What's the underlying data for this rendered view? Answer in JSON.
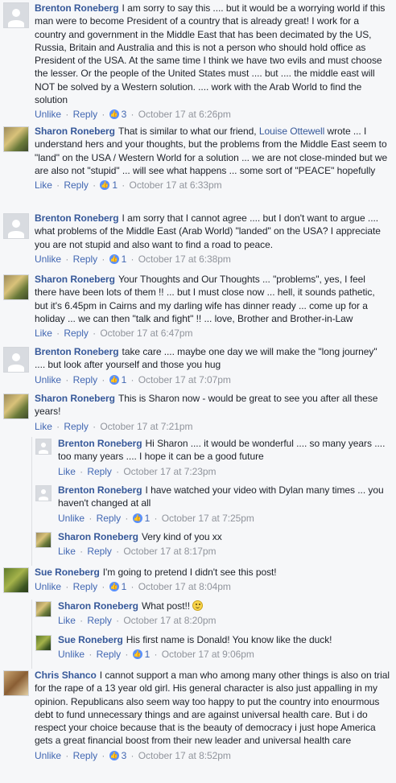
{
  "actions": {
    "like": "Like",
    "unlike": "Unlike",
    "reply": "Reply",
    "sep": "·"
  },
  "comments": [
    {
      "author": "Brenton Roneberg",
      "avatar": "default-avatar",
      "text": "I am sorry to say this .... but it would be a worrying world if this man were to become President of a country that is already great! I work for a country and government in the Middle East that has been decimated by the US, Russia, Britain and Australia and this is not a person who should hold office as President of the USA. At the same time I think we have two evils and must choose the lesser. Or the people of the United States must .... but .... the middle east will NOT be solved by a Western solution. .... work with the Arab World to find the solution",
      "like_action": "Unlike",
      "like_count": "3",
      "time": "October 17 at 6:26pm"
    },
    {
      "author": "Sharon Roneberg",
      "avatar": "sharon-photo",
      "text_before": "That is similar to what our friend,",
      "mention": "Louise Ottewell",
      "text_after": "wrote ... I understand hers and your thoughts, but the problems from the Middle East seem to \"land\" on the USA / Western World for a solution ... we are not close-minded but we are also not \"stupid\" ... will see what happens ... some sort of \"PEACE\" hopefully",
      "like_action": "Like",
      "like_count": "1",
      "time": "October 17 at 6:33pm"
    },
    {
      "author": "Brenton Roneberg",
      "avatar": "default-avatar",
      "text": "I am sorry that I cannot agree .... but I don't want to argue .... what problems of the Middle East (Arab World) \"landed\" on the USA? I appreciate you are not stupid and also want to find a road to peace.",
      "like_action": "Unlike",
      "like_count": "1",
      "time": "October 17 at 6:38pm"
    },
    {
      "author": "Sharon Roneberg",
      "avatar": "sharon-photo",
      "text": "Your Thoughts and Our Thoughts ... \"problems\", yes, I feel there have been lots of them !! ... but I must close now ... hell, it sounds pathetic, but it's 6.45pm in Cairns and my darling wife has dinner ready ... come up for a holiday ... we can then \"talk and fight\" !! ... love, Brother and Brother-in-Law",
      "like_action": "Like",
      "time": "October 17 at 6:47pm"
    },
    {
      "author": "Brenton Roneberg",
      "avatar": "default-avatar",
      "text": "take care .... maybe one day we will make the \"long journey\" .... but look after yourself and those you hug",
      "like_action": "Unlike",
      "like_count": "1",
      "time": "October 17 at 7:07pm"
    },
    {
      "author": "Sharon Roneberg",
      "avatar": "sharon-photo",
      "text": "This is Sharon now - would be great to see you after all these years!",
      "like_action": "Like",
      "time": "October 17 at 7:21pm",
      "replies": [
        {
          "author": "Brenton Roneberg",
          "avatar": "default-avatar",
          "text": "Hi Sharon .... it would be wonderful .... so many years .... too many years .... I hope it can be a good future",
          "like_action": "Like",
          "time": "October 17 at 7:23pm"
        },
        {
          "author": "Brenton Roneberg",
          "avatar": "default-avatar",
          "text": "I have watched your video with Dylan many times ... you haven't changed at all",
          "like_action": "Unlike",
          "like_count": "1",
          "time": "October 17 at 7:25pm"
        },
        {
          "author": "Sharon Roneberg",
          "avatar": "sharon-photo",
          "text": "Very kind of you xx",
          "like_action": "Like",
          "time": "October 17 at 8:17pm"
        }
      ]
    },
    {
      "author": "Sue Roneberg",
      "avatar": "sue-photo",
      "text": "I'm going to pretend I didn't see this post!",
      "like_action": "Unlike",
      "like_count": "1",
      "time": "October 17 at 8:04pm",
      "replies": [
        {
          "author": "Sharon Roneberg",
          "avatar": "sharon-photo",
          "text": "What post!!",
          "emoji": "smile-icon",
          "like_action": "Like",
          "time": "October 17 at 8:20pm"
        },
        {
          "author": "Sue Roneberg",
          "avatar": "sue-photo",
          "text": "His first name is Donald! You know like the duck!",
          "like_action": "Unlike",
          "like_count": "1",
          "time": "October 17 at 9:06pm"
        }
      ]
    },
    {
      "author": "Chris Shanco",
      "avatar": "chris-photo",
      "text": "I cannot support a man who among many other things is also on trial for the rape of a 13 year old girl. His general character is also just appalling in my opinion. Republicans also seem way too happy to put the country into enourmous debt to fund unnecessary things and are against universal health care. But i do respect your choice because that is the beauty of democracy i just hope America gets a great financial boost from their new leader and universal health care",
      "like_action": "Unlike",
      "like_count": "3",
      "time": "October 17 at 8:52pm"
    }
  ]
}
